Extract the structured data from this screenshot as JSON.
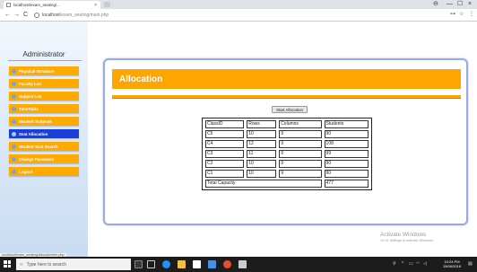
{
  "browser": {
    "tab_title": "localhost/exam_seating/...",
    "tab_close": "×",
    "url_host": "localhost",
    "url_path": "/exam_seating/main.php",
    "back": "←",
    "forward": "→",
    "reload": "C",
    "minimize": "—",
    "maximize": "☐",
    "close": "×",
    "account": "⊖",
    "extensions": "⊶",
    "star": "☆",
    "menu": "⋮"
  },
  "sidebar": {
    "title": "Administrator",
    "items": [
      {
        "label": "Physical Structure",
        "active": false
      },
      {
        "label": "Faculty List",
        "active": false
      },
      {
        "label": "Subject List",
        "active": false
      },
      {
        "label": "TimeTable",
        "active": false
      },
      {
        "label": "Student Subjects",
        "active": false
      },
      {
        "label": "Seat Allocation",
        "active": true
      },
      {
        "label": "Student Seat Search",
        "active": false
      },
      {
        "label": "Change Password",
        "active": false
      },
      {
        "label": "Logout",
        "active": false
      }
    ]
  },
  "main": {
    "title": "Allocation",
    "start_button": "Start Allocation",
    "table": {
      "headers": [
        "ClassID",
        "Rows",
        "Columns",
        "Students"
      ],
      "rows": [
        [
          "C5",
          "10",
          "9",
          "90"
        ],
        [
          "C4",
          "12",
          "9",
          "108"
        ],
        [
          "C3",
          "11",
          "9",
          "99"
        ],
        [
          "C2",
          "10",
          "9",
          "90"
        ],
        [
          "C1",
          "10",
          "9",
          "90"
        ]
      ],
      "total_label": "Total Capacity",
      "total_value": "477"
    }
  },
  "status_url": "localhost/exam_seating/allocationfrm.php",
  "watermark": {
    "line1": "Activate Windows",
    "line2": "Go to Settings to activate Windows."
  },
  "taskbar": {
    "search_placeholder": "Type here to search",
    "time": "10:24 PM",
    "date": "15/06/2018"
  },
  "colors": {
    "accent": "#ffa500",
    "menu_active": "#1a3fd8",
    "panel_border": "#9aa8e8"
  }
}
